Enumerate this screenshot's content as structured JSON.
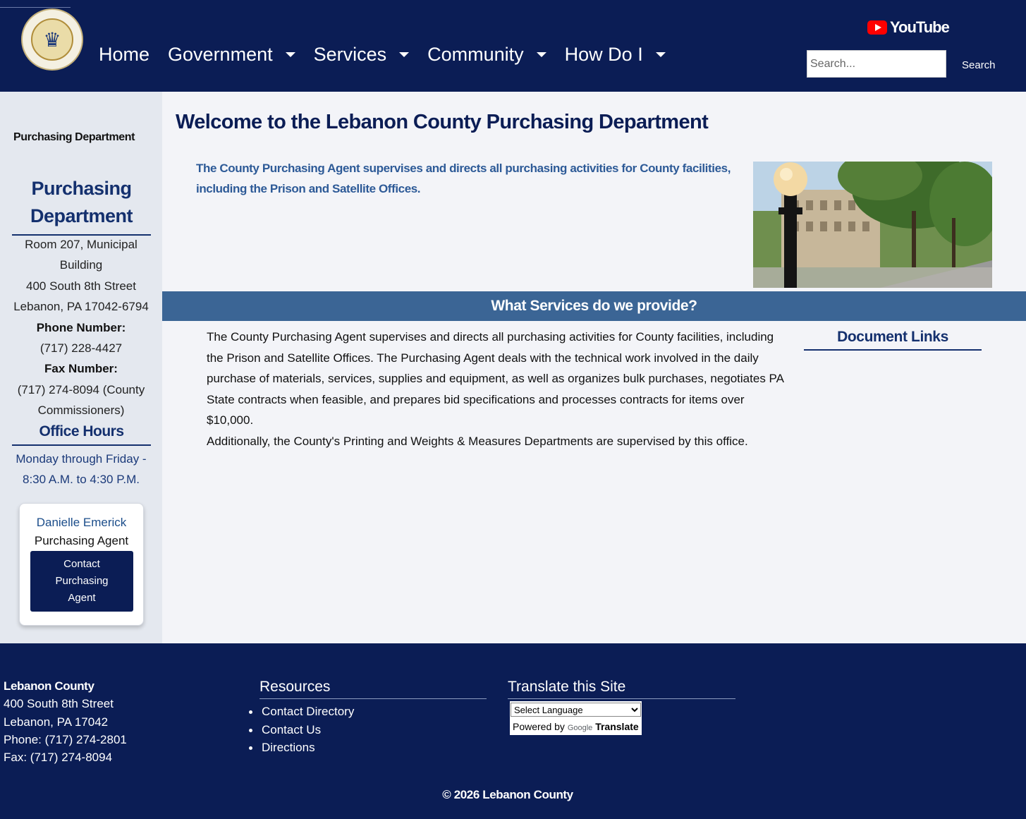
{
  "header": {
    "nav": [
      {
        "label": "Home",
        "has_dropdown": false
      },
      {
        "label": "Government",
        "has_dropdown": true
      },
      {
        "label": "Services",
        "has_dropdown": true
      },
      {
        "label": "Community",
        "has_dropdown": true
      },
      {
        "label": "How Do I",
        "has_dropdown": true
      }
    ],
    "youtube_label": "YouTube",
    "search_placeholder": "Search...",
    "search_button": "Search",
    "colors": {
      "background": "#0b1d55"
    }
  },
  "sidebar": {
    "breadcrumb": "Purchasing Department",
    "title": "Purchasing Department",
    "address_line1": "Room 207, Municipal Building",
    "address_line2": "400 South 8th Street",
    "address_line3": "Lebanon, PA 17042-6794",
    "phone_label": "Phone Number:",
    "phone": "(717) 228-4427",
    "fax_label": "Fax Number:",
    "fax": "(717) 274-8094 (County Commissioners)",
    "hours_title": "Office Hours",
    "hours": "Monday through Friday - 8:30 A.M. to 4:30 P.M.",
    "contact": {
      "name": "Danielle Emerick",
      "role": "Purchasing Agent",
      "button": "Contact Purchasing Agent"
    }
  },
  "main": {
    "title": "Welcome to the Lebanon County Purchasing Department",
    "intro": "The County Purchasing Agent supervises and directs all purchasing activities for County facilities, including the Prison and Satellite Offices.",
    "services_heading": "What Services do we provide?",
    "body_paragraph": "The County Purchasing Agent supervises and directs all purchasing activities for County facilities, including the Prison and Satellite Offices. The Purchasing Agent deals with the technical work involved in the daily purchase of materials, services, supplies and equipment, as well as organizes bulk purchases, negotiates PA State contracts when feasible, and prepares bid specifications and processes contracts for items over $10,000.",
    "body_paragraph2": "Additionally, the County's Printing and Weights & Measures Departments are supervised by this office.",
    "document_links_heading": "Document Links"
  },
  "footer": {
    "org_name": "Lebanon County",
    "street": "400 South 8th Street",
    "city": "Lebanon, PA 17042",
    "phone": "Phone: (717) 274-2801",
    "fax": "Fax: (717) 274-8094",
    "resources_heading": "Resources",
    "resources": [
      "Contact Directory",
      "Contact Us",
      "Directions"
    ],
    "translate_heading": "Translate this Site",
    "translate_select": "Select Language",
    "powered_by": "Powered by",
    "google": "Google",
    "translate": "Translate",
    "copyright": "© 2026 Lebanon County"
  }
}
